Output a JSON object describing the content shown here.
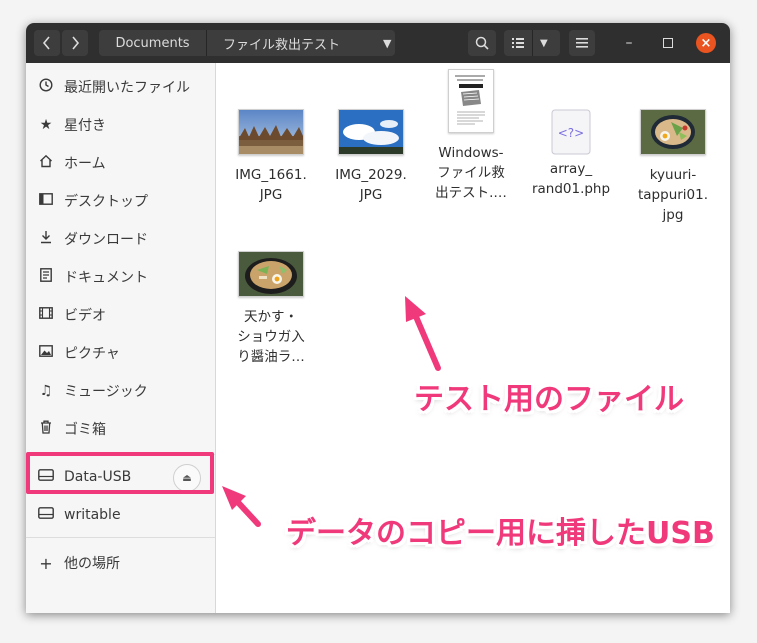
{
  "header": {
    "back_icon": "chevron-left",
    "forward_icon": "chevron-right",
    "breadcrumb_parent": "Documents",
    "breadcrumb_current": "ファイル救出テスト",
    "search_icon": "search",
    "view_list_icon": "list-view",
    "menu_icon": "hamburger",
    "minimize": "–",
    "maximize": "□",
    "close": "×"
  },
  "sidebar": {
    "items": [
      {
        "label": "最近開いたファイル",
        "icon": "clock-icon"
      },
      {
        "label": "星付き",
        "icon": "star-icon"
      },
      {
        "label": "ホーム",
        "icon": "home-icon"
      },
      {
        "label": "デスクトップ",
        "icon": "desktop-icon"
      },
      {
        "label": "ダウンロード",
        "icon": "download-icon"
      },
      {
        "label": "ドキュメント",
        "icon": "document-icon"
      },
      {
        "label": "ビデオ",
        "icon": "video-icon"
      },
      {
        "label": "ピクチャ",
        "icon": "picture-icon"
      },
      {
        "label": "ミュージック",
        "icon": "music-icon"
      },
      {
        "label": "ゴミ箱",
        "icon": "trash-icon"
      }
    ],
    "devices": [
      {
        "label": "Data-USB",
        "icon": "drive-icon"
      },
      {
        "label": "writable",
        "icon": "drive-icon"
      }
    ],
    "other_locations": "他の場所"
  },
  "files": [
    {
      "name": "IMG_1661.\nJPG",
      "type": "photo-trees"
    },
    {
      "name": "IMG_2029.\nJPG",
      "type": "photo-sky"
    },
    {
      "name": "Windows-\nファイル救\n出テスト.…",
      "type": "document"
    },
    {
      "name": "array_\nrand01.php",
      "type": "php"
    },
    {
      "name": "kyuuri-\ntappuri01.\njpg",
      "type": "photo-food"
    },
    {
      "name": "天かす・\nショウガ入\nり醤油ラ…",
      "type": "photo-food2"
    }
  ],
  "annotations": {
    "files_note": "テスト用のファイル",
    "usb_note": "データのコピー用に挿したUSB",
    "accent": "#f0397a"
  }
}
